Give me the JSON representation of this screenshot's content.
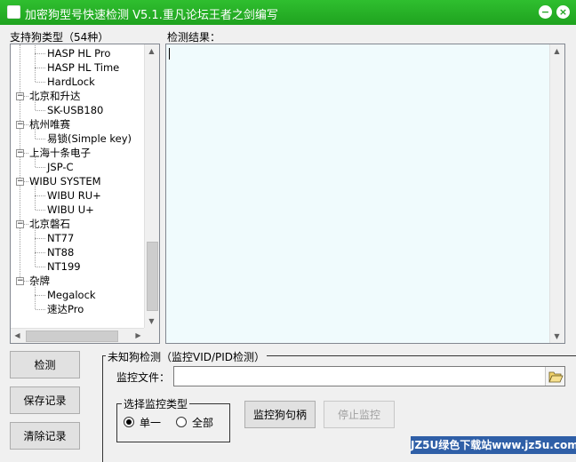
{
  "window": {
    "title": "加密狗型号快速检测 V5.1.重凡论坛王者之剑编写",
    "minimize_glyph": "−",
    "close_glyph": "×"
  },
  "left_panel": {
    "caption": "支持狗类型（54种）",
    "tree": [
      {
        "label": "HASP HL Pro",
        "level": 1
      },
      {
        "label": "HASP HL Time",
        "level": 1
      },
      {
        "label": "HardLock",
        "level": 1
      },
      {
        "label": "北京和升达",
        "level": 0,
        "toggle": "−"
      },
      {
        "label": "SK-USB180",
        "level": 1
      },
      {
        "label": "杭州唯赛",
        "level": 0,
        "toggle": "−"
      },
      {
        "label": "易锁(Simple key)",
        "level": 1
      },
      {
        "label": "上海十条电子",
        "level": 0,
        "toggle": "−"
      },
      {
        "label": "JSP-C",
        "level": 1
      },
      {
        "label": "WIBU SYSTEM",
        "level": 0,
        "toggle": "−"
      },
      {
        "label": "WIBU RU+",
        "level": 1
      },
      {
        "label": "WIBU U+",
        "level": 1
      },
      {
        "label": "北京磐石",
        "level": 0,
        "toggle": "−"
      },
      {
        "label": "NT77",
        "level": 1
      },
      {
        "label": "NT88",
        "level": 1
      },
      {
        "label": "NT199",
        "level": 1
      },
      {
        "label": "杂牌",
        "level": 0,
        "toggle": "−"
      },
      {
        "label": "Megalock",
        "level": 1
      },
      {
        "label": "速达Pro",
        "level": 1
      }
    ]
  },
  "result_panel": {
    "caption": "检测结果：",
    "content": ""
  },
  "buttons": {
    "detect": "检测",
    "save_log": "保存记录",
    "clear_log": "清除记录",
    "monitor_handle": "监控狗句柄",
    "stop_monitor": "停止监控"
  },
  "unknown_group": {
    "caption": "未知狗检测（监控VID/PID检测）",
    "file_label": "监控文件：",
    "file_value": ""
  },
  "monitor_type": {
    "caption": "选择监控类型",
    "options": [
      {
        "label": "单一",
        "checked": true
      },
      {
        "label": "全部",
        "checked": false
      }
    ]
  },
  "watermark": "JZ5U绿色下载站www.jz5u.com",
  "colors": {
    "titlebar": "#1fa31f",
    "result_bg": "#f0fbfd",
    "watermark_bg": "#2f5fa7"
  }
}
